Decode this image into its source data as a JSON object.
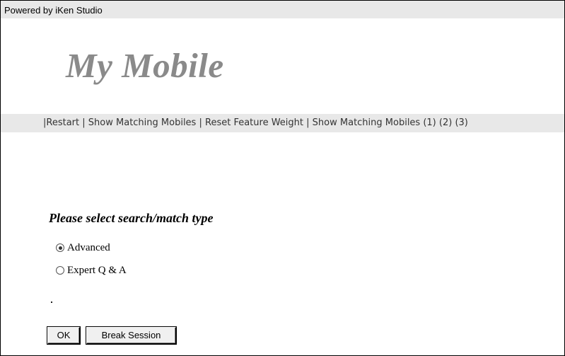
{
  "powered_by": "Powered by iKen Studio",
  "logo": "My Mobile",
  "nav": {
    "lead_sep": "|",
    "sep": "|",
    "restart": "Restart",
    "show_matching": "Show Matching Mobiles",
    "reset_weight": "Reset Feature Weight",
    "show_matching_pages": "Show Matching Mobiles",
    "page1": "(1)",
    "page2": "(2)",
    "page3": "(3)"
  },
  "form": {
    "heading": "Please select search/match type",
    "options": [
      {
        "label": "Advanced",
        "checked": true
      },
      {
        "label": "Expert Q & A",
        "checked": false
      }
    ],
    "ok_label": "OK",
    "break_label": "Break Session"
  }
}
